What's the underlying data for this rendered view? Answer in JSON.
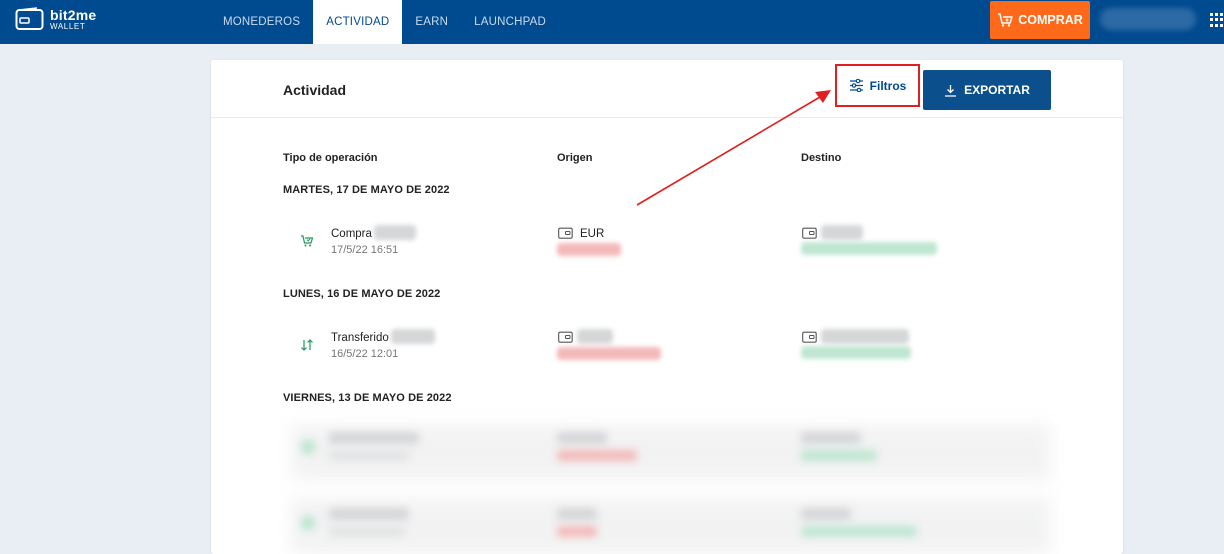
{
  "brand": {
    "name": "bit2me",
    "subtitle": "WALLET"
  },
  "nav": {
    "items": [
      {
        "label": "MONEDEROS",
        "active": false
      },
      {
        "label": "ACTIVIDAD",
        "active": true
      },
      {
        "label": "EARN",
        "active": false
      },
      {
        "label": "LAUNCHPAD",
        "active": false
      }
    ],
    "buy_label": "COMPRAR"
  },
  "activity": {
    "title": "Actividad",
    "filter_label": "Filtros",
    "export_label": "EXPORTAR",
    "columns": {
      "type": "Tipo de operación",
      "origin": "Origen",
      "destination": "Destino"
    },
    "groups": [
      {
        "date": "MARTES, 17 DE MAYO DE 2022",
        "operations": [
          {
            "type": "Compra",
            "time": "17/5/22 16:51",
            "origin": "EUR",
            "icon": "cart-icon"
          }
        ]
      },
      {
        "date": "LUNES, 16 DE MAYO DE 2022",
        "operations": [
          {
            "type": "Transferido",
            "time": "16/5/22 12:01",
            "origin": "",
            "icon": "transfer-arrows-icon"
          }
        ]
      },
      {
        "date": "VIERNES, 13 DE MAYO DE 2022",
        "operations": []
      }
    ]
  },
  "colors": {
    "nav_bg": "#004a8f",
    "buy_button": "#ff6a1a",
    "export_button": "#0b4f8c",
    "highlight": "#e02020",
    "positive": "#1a9b5c"
  }
}
